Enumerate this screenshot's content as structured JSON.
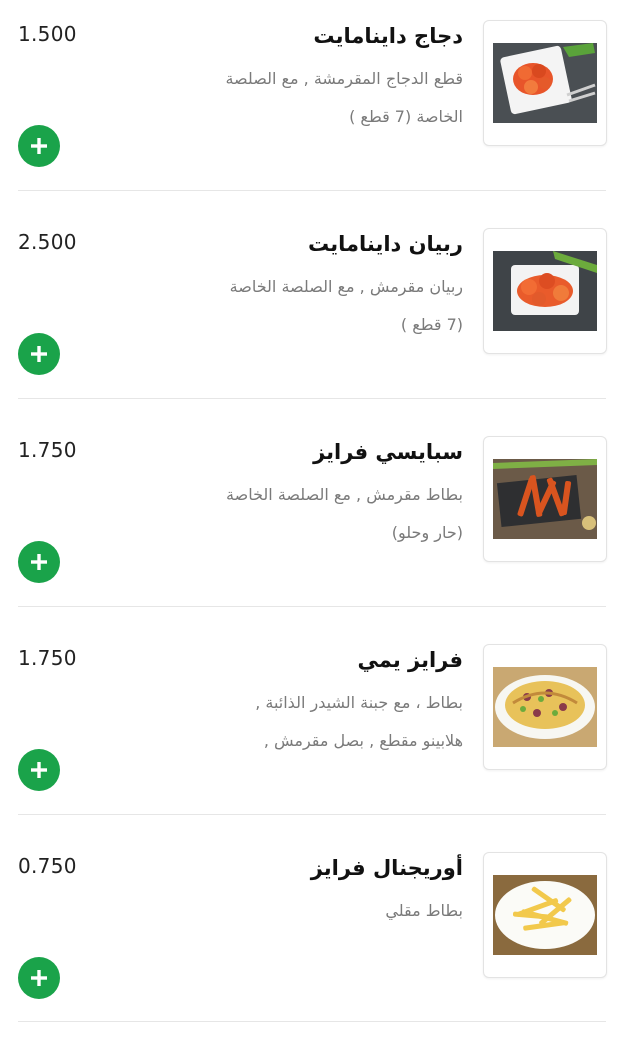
{
  "accent_color": "#1aa34a",
  "items": [
    {
      "title": "دجاج داينامايت",
      "desc_line1": "قطع الدجاج المقرمشة , مع الصلصة",
      "desc_line2": "الخاصة (7 قطع )",
      "price": "1.500",
      "image": "dynamite-chicken-photo",
      "add_icon": "plus-icon"
    },
    {
      "title": "ربيان داينامايت",
      "desc_line1": "ربيان مقرمش , مع الصلصة الخاصة",
      "desc_line2": "(7 قطع )",
      "price": "2.500",
      "image": "dynamite-shrimp-photo",
      "add_icon": "plus-icon"
    },
    {
      "title": "سبايسي فرايز",
      "desc_line1": "بطاط مقرمش , مع الصلصة الخاصة",
      "desc_line2": "(حار وحلو)",
      "price": "1.750",
      "image": "spicy-fries-photo",
      "add_icon": "plus-icon"
    },
    {
      "title": "فرايز يمي",
      "desc_line1": "بطاط ، مع جبنة الشيدر الذائبة ,",
      "desc_line2": "هلابينو مقطع , بصل مقرمش ,",
      "price": "1.750",
      "image": "yummy-fries-photo",
      "add_icon": "plus-icon"
    },
    {
      "title": "أوريجنال فرايز",
      "desc_line1": "بطاط مقلي",
      "desc_line2": "",
      "price": "0.750",
      "image": "original-fries-photo",
      "add_icon": "plus-icon"
    }
  ]
}
